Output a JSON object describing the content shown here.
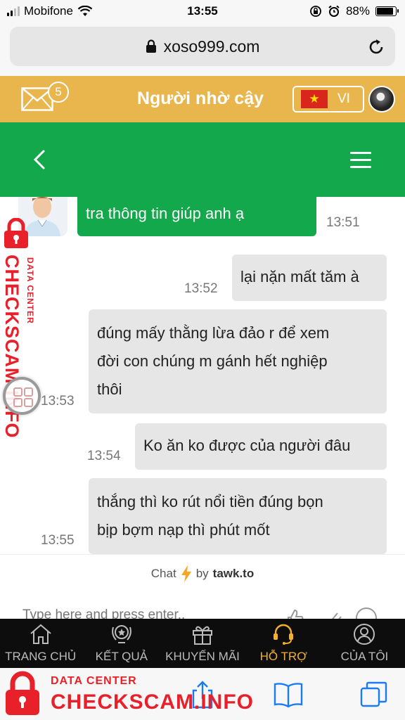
{
  "status_bar": {
    "carrier": "Mobifone",
    "time": "13:55",
    "battery": "88%",
    "battery_level": 0.88
  },
  "browser": {
    "url": "xoso999.com"
  },
  "site_header": {
    "mail_badge": "5",
    "title": "Người nhờ cậy",
    "language": "VI",
    "flag_symbol": "★"
  },
  "chat": {
    "messages": [
      {
        "sender": "agent",
        "text": "tra thông tin giúp anh ạ",
        "time": "13:51"
      },
      {
        "sender": "visitor",
        "text": "lại nặn mất tăm à",
        "time": "13:52"
      },
      {
        "sender": "visitor",
        "lines": [
          "đúng mấy thằng lừa đảo r để xem",
          "đời con chúng m gánh hết nghiệp",
          "thôi"
        ],
        "time": "13:53"
      },
      {
        "sender": "visitor",
        "text": "Ko ăn ko được của người đâu",
        "time": "13:54"
      },
      {
        "sender": "visitor",
        "lines": [
          "thắng thì ko rút nổi tiền đúng bọn",
          "bịp bợm nạp thì phút mốt"
        ],
        "time": "13:55"
      }
    ],
    "branding": {
      "prefix": "Chat",
      "by": "by",
      "brand": "tawk.to"
    },
    "compose_placeholder": "Type here and press enter.."
  },
  "site_nav": [
    {
      "label": "TRANG CHỦ",
      "icon": "home-icon"
    },
    {
      "label": "KẾT QUẢ",
      "icon": "trophy-icon"
    },
    {
      "label": "KHUYẾN MÃI",
      "icon": "gift-icon"
    },
    {
      "label": "HỖ TRỢ",
      "icon": "headset-icon",
      "active": true
    },
    {
      "label": "CỦA TÔI",
      "icon": "user-icon"
    }
  ],
  "watermark": {
    "small": "DATA CENTER",
    "big": "CHECKSCAM.INFO"
  },
  "colors": {
    "header_gold": "#e9b64d",
    "chat_green": "#13a84c",
    "nav_active": "#f3b02b",
    "watermark_red": "#e8202a"
  }
}
